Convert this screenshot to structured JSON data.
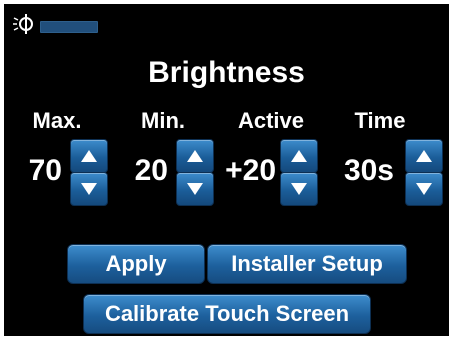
{
  "title": "Brightness",
  "level_fill_fraction": 1.0,
  "columns": [
    {
      "label": "Max.",
      "value": "70"
    },
    {
      "label": "Min.",
      "value": "20"
    },
    {
      "label": "Active",
      "value": "+20"
    },
    {
      "label": "Time",
      "value": "30s"
    }
  ],
  "buttons": {
    "apply": "Apply",
    "installer_setup": "Installer Setup",
    "calibrate": "Calibrate Touch Screen"
  },
  "colors": {
    "background": "#000000",
    "button": "#1d609d",
    "text": "#ffffff"
  },
  "icons": {
    "brightness": "brightness-icon",
    "up": "up-arrow-icon",
    "down": "down-arrow-icon"
  }
}
